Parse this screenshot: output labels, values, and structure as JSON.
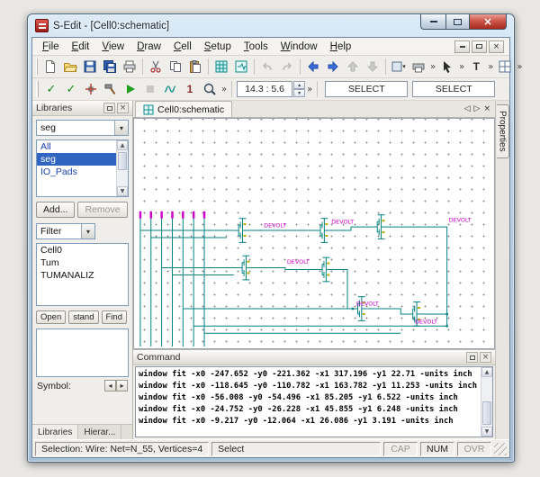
{
  "window": {
    "title": "S-Edit - [Cell0:schematic]"
  },
  "menu": {
    "items": [
      {
        "label": "File"
      },
      {
        "label": "Edit"
      },
      {
        "label": "View"
      },
      {
        "label": "Draw"
      },
      {
        "label": "Cell"
      },
      {
        "label": "Setup"
      },
      {
        "label": "Tools"
      },
      {
        "label": "Window"
      },
      {
        "label": "Help"
      }
    ]
  },
  "toolbar": {
    "coords_display": "14.3 : 5.6",
    "select_left": "SELECT",
    "select_right": "SELECT",
    "text_tool": "T",
    "trace_one": "1"
  },
  "libraries_panel": {
    "title": "Libraries",
    "library_combo": "seg",
    "library_list": [
      {
        "label": "All"
      },
      {
        "label": "seg"
      },
      {
        "label": "IO_Pads"
      }
    ],
    "add_button": "Add...",
    "remove_button": "Remove",
    "filter_combo": "Filter",
    "cell_list": [
      {
        "label": "Cell0"
      },
      {
        "label": "Tum"
      },
      {
        "label": "TUMANALIZ"
      }
    ],
    "open_button": "Open",
    "instance_button": "stand",
    "find_button": "Find",
    "symbol_label": "Symbol:",
    "tab_libraries": "Libraries",
    "tab_hierarchy": "Hierar..."
  },
  "document": {
    "tab_label": "Cell0:schematic"
  },
  "properties": {
    "tab_label": "Properties"
  },
  "schematic": {
    "net_labels": [
      {
        "text": "DEVOLT"
      },
      {
        "text": "DEVOLT"
      },
      {
        "text": "DEVOLT"
      },
      {
        "text": "DEVOLT"
      },
      {
        "text": "DEVOLT"
      },
      {
        "text": "DEVOLT"
      }
    ]
  },
  "command_panel": {
    "title": "Command",
    "lines": [
      {
        "text": "window fit -x0 -247.652 -y0 -221.362 -x1 317.196 -y1 22.71 -units inch"
      },
      {
        "text": "window fit -x0 -118.645 -y0 -110.782 -x1 163.782 -y1 11.253 -units inch"
      },
      {
        "text": "window fit -x0 -56.008 -y0 -54.496 -x1 85.205 -y1 6.522 -units inch"
      },
      {
        "text": "window fit -x0 -24.752 -y0 -26.228 -x1 45.855 -y1 6.248 -units inch"
      },
      {
        "text": "window fit -x0 -9.217 -y0 -12.064 -x1 26.086 -y1 3.191 -units inch"
      }
    ]
  },
  "status_bar": {
    "selection_text": "Selection: Wire: Net=N_55, Vertices=4",
    "mode_text": "Select",
    "cap": "CAP",
    "num": "NUM",
    "ovr": "OVR"
  },
  "glyphs": {
    "overflow": "»",
    "dropdown": "▾",
    "spin_up": "▴",
    "spin_down": "▾",
    "close": "×",
    "prev": "◂",
    "next": "▸",
    "doc_prev": "◁",
    "doc_next": "▷",
    "scroll_up": "▲",
    "scroll_down": "▼",
    "check": "✓"
  }
}
